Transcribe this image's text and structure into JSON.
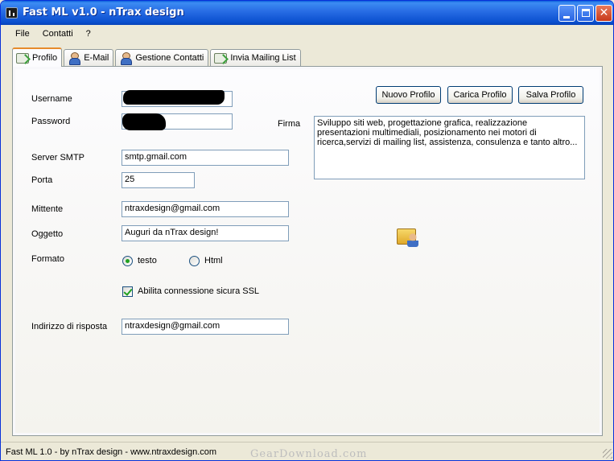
{
  "window": {
    "title": "Fast ML v1.0 - nTrax design",
    "controls": {
      "minimize": "minimize-icon",
      "maximize": "maximize-icon",
      "close": "close-icon"
    }
  },
  "menu": {
    "items": [
      "File",
      "Contatti",
      "?"
    ]
  },
  "tabs": [
    {
      "label": "Profilo",
      "icon": "envelope-check-icon",
      "active": true
    },
    {
      "label": "E-Mail",
      "icon": "user-icon",
      "active": false
    },
    {
      "label": "Gestione Contatti",
      "icon": "user-icon",
      "active": false
    },
    {
      "label": "Invia Mailing List",
      "icon": "envelope-check-icon",
      "active": false
    }
  ],
  "profile": {
    "labels": {
      "username": "Username",
      "password": "Password",
      "server_smtp": "Server SMTP",
      "porta": "Porta",
      "mittente": "Mittente",
      "oggetto": "Oggetto",
      "formato": "Formato",
      "indirizzo": "Indirizzo di risposta",
      "firma": "Firma"
    },
    "values": {
      "username": "",
      "password": "",
      "server_smtp": "smtp.gmail.com",
      "porta": "25",
      "mittente": "ntraxdesign@gmail.com",
      "oggetto": "Auguri da nTrax design!",
      "indirizzo": "ntraxdesign@gmail.com",
      "firma": "Sviluppo siti web, progettazione grafica, realizzazione presentazioni multimediali, posizionamento nei motori di ricerca,servizi di mailing list, assistenza, consulenza e tanto altro..."
    },
    "formato": {
      "options": [
        "testo",
        "Html"
      ],
      "selected": "testo"
    },
    "ssl": {
      "label": "Abilita connessione sicura SSL",
      "checked": true
    },
    "buttons": {
      "nuovo": "Nuovo Profilo",
      "carica": "Carica Profilo",
      "salva": "Salva Profilo"
    },
    "folder_icon": "folder-user-icon"
  },
  "statusbar": {
    "text": "Fast ML 1.0 - by nTrax design - www.ntraxdesign.com"
  },
  "watermark": {
    "text": "GearDownload.com"
  },
  "colors": {
    "titlebar": "#0a4fcf",
    "window_bg": "#ece9d8",
    "active_tab_accent": "#e68b2c",
    "radio_dot": "#21a121"
  }
}
